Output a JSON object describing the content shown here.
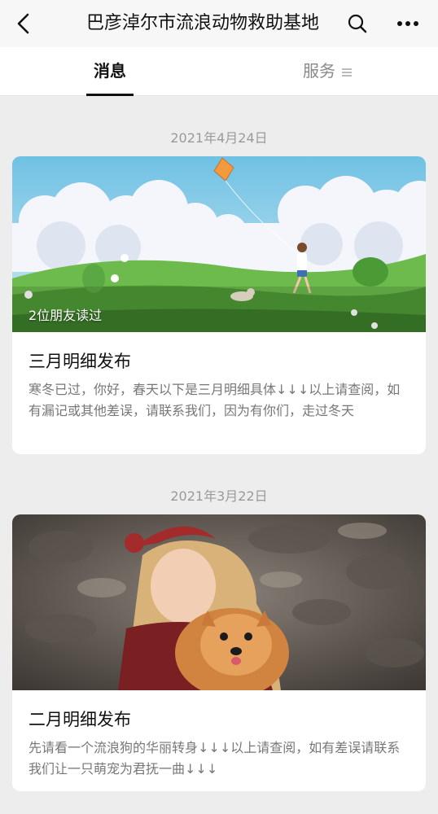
{
  "header": {
    "title": "巴彦淖尔市流浪动物救助基地"
  },
  "tabs": [
    {
      "label": "消息",
      "active": true
    },
    {
      "label": "服务",
      "icon": "menu-lines-icon"
    }
  ],
  "articles": [
    {
      "date": "2021年4月24日",
      "image": "kite-girl-dog-illustration",
      "badge": "2位朋友读过",
      "title": "三月明细发布",
      "summary": "寒冬已过，你好，春天以下是三月明细具体↓↓↓以上请查阅，如有漏记或其他差误，请联系我们，因为有你们，走过冬天"
    },
    {
      "date": "2021年3月22日",
      "image": "girl-with-pomeranian-photo",
      "title": "二月明细发布",
      "summary": "先请看一个流浪狗的华丽转身↓↓↓以上请查阅，如有差误请联系我们让一只萌宠为君抚一曲↓↓↓"
    }
  ],
  "colors": {
    "background": "#ededed",
    "card": "#ffffff",
    "muted_text": "#777777",
    "date_text": "#9a9a9a"
  }
}
